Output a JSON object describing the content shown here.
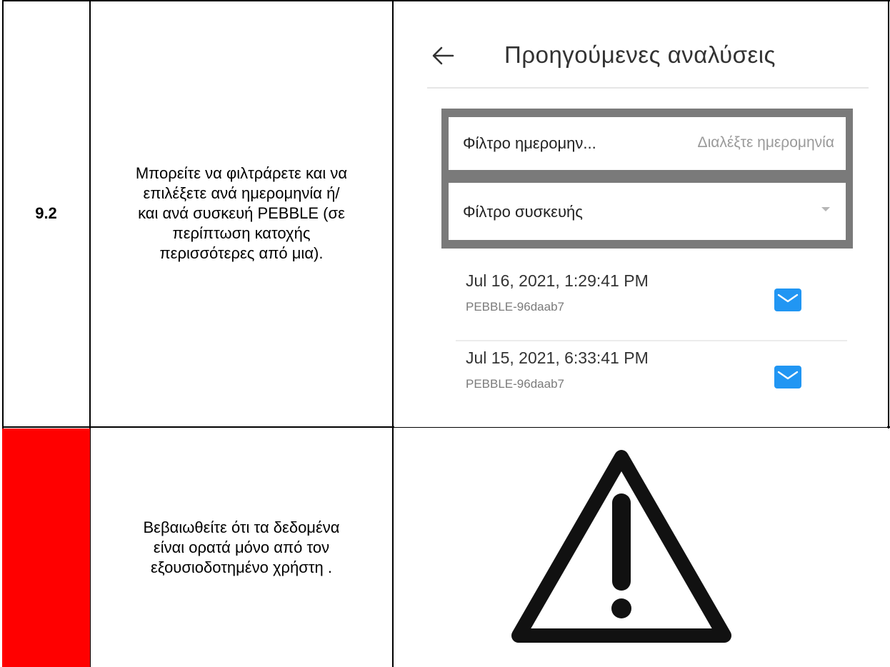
{
  "rows": [
    {
      "step": "9.2",
      "text_lines": [
        "Μπορείτε να φιλτράρετε και να",
        "επιλέξετε ανά ημερομηνία ή/",
        "και ανά συσκευή PEBBLE (σε",
        "περίπτωση κατοχής",
        "περισσότερες από μια)."
      ]
    },
    {
      "step": "",
      "text_lines": [
        "Βεβαιωθείτε ότι τα δεδομένα",
        "είναι ορατά μόνο από τον",
        "εξουσιοδοτημένο χρήστη ."
      ],
      "accent": "#ff0000"
    }
  ],
  "screenshot": {
    "back_icon": "arrow-left-icon",
    "title": "Προηγούμενες αναλύσεις",
    "filters": {
      "date_label": "Φίλτρο ημερομην...",
      "date_placeholder": "Διαλέξτε ημερομηνία",
      "device_label": "Φίλτρο συσκευής",
      "device_icon": "dropdown-arrow-icon"
    },
    "items": [
      {
        "date": "Jul 16, 2021, 1:29:41 PM",
        "device": "PEBBLE-96daab7",
        "icon": "mail-icon"
      },
      {
        "date": "Jul 15, 2021, 6:33:41 PM",
        "device": "PEBBLE-96daab7",
        "icon": "mail-icon"
      }
    ],
    "accent": "#2196f3"
  },
  "warning_icon": "warning-triangle-icon"
}
